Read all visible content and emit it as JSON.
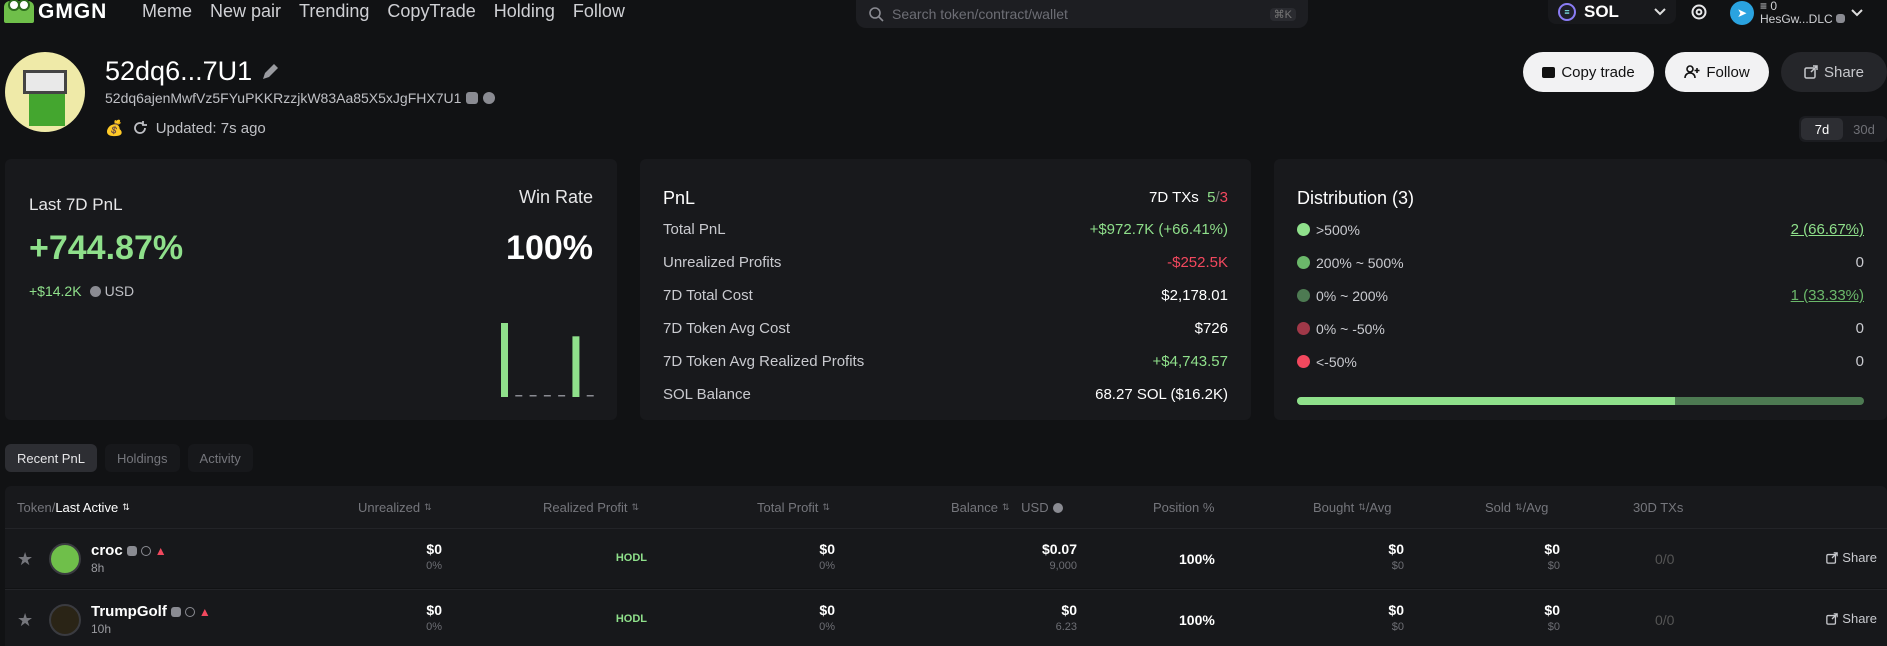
{
  "nav": {
    "logo_text": "GMGN",
    "items": [
      "Meme",
      "New pair",
      "Trending",
      "CopyTrade",
      "Holding",
      "Follow"
    ],
    "search_placeholder": "Search token/contract/wallet",
    "search_shortcut": "⌘K",
    "chain": "SOL",
    "account_balance": "0",
    "account_name": "HesGw...DLC"
  },
  "profile": {
    "title": "52dq6...7U1",
    "address": "52dq6ajenMwfVz5FYuPKKRzzjkW83Aa85X5xJgFHX7U1",
    "updated": "Updated: 7s ago",
    "buttons": {
      "copy_trade": "Copy trade",
      "follow": "Follow",
      "share": "Share"
    },
    "period_tabs": [
      "7d",
      "30d"
    ],
    "period_active": "7d"
  },
  "pnl_card": {
    "label": "Last 7D PnL",
    "value": "+744.87%",
    "usd_value": "+$14.2K",
    "usd_label": "USD",
    "win_rate_label": "Win Rate",
    "win_rate_value": "100%",
    "mini_bars": [
      1,
      0,
      0,
      0,
      0,
      0.82,
      0
    ]
  },
  "stats_card": {
    "title": "PnL",
    "txs_label": "7D TXs",
    "txs_win": "5",
    "txs_sep": "/",
    "txs_loss": "3",
    "rows": [
      {
        "label": "Total PnL",
        "value": "+$972.7K (+66.41%)",
        "tone": "green"
      },
      {
        "label": "Unrealized Profits",
        "value": "-$252.5K",
        "tone": "red"
      },
      {
        "label": "7D Total Cost",
        "value": "$2,178.01",
        "tone": "white"
      },
      {
        "label": "7D Token Avg Cost",
        "value": "$726",
        "tone": "white"
      },
      {
        "label": "7D Token Avg Realized Profits",
        "value": "+$4,743.57",
        "tone": "green"
      },
      {
        "label": "SOL Balance",
        "value": "68.27 SOL ($16.2K)",
        "tone": "white"
      }
    ]
  },
  "distribution": {
    "title": "Distribution (3)",
    "rows": [
      {
        "label": ">500%",
        "value": "2 (66.67%)",
        "color": "#8fe08b",
        "underline": true,
        "tone": "#8fe08b"
      },
      {
        "label": "200% ~ 500%",
        "value": "0",
        "color": "#6bb86a",
        "underline": false,
        "tone": "#c9cacf"
      },
      {
        "label": "0% ~ 200%",
        "value": "1 (33.33%)",
        "color": "#4d7a52",
        "underline": true,
        "tone": "#6bb86a"
      },
      {
        "label": "0% ~ -50%",
        "value": "0",
        "color": "#a03848",
        "underline": false,
        "tone": "#c9cacf"
      },
      {
        "label": "<-50%",
        "value": "0",
        "color": "#f2485e",
        "underline": false,
        "tone": "#c9cacf"
      }
    ],
    "bar_fill_fraction": 0.6667
  },
  "tabs": {
    "items": [
      "Recent PnL",
      "Holdings",
      "Activity"
    ],
    "active": "Recent PnL"
  },
  "table": {
    "headers": {
      "token": "Token/",
      "last_active": "Last Active",
      "unrealized": "Unrealized",
      "realized": "Realized Profit",
      "total": "Total Profit",
      "balance": "Balance",
      "usd": "USD",
      "position": "Position %",
      "bought": "Bought",
      "bought_avg": "/Avg",
      "sold": "Sold",
      "sold_avg": "/Avg",
      "txs": "30D TXs"
    },
    "rows": [
      {
        "name": "croc",
        "time": "8h",
        "unrealized": "$0",
        "unrealized_pct": "0%",
        "realized": "HODL",
        "total": "$0",
        "total_pct": "0%",
        "balance_usd": "$0.07",
        "balance_amt": "9,000",
        "position": "100%",
        "bought": "$0",
        "bought_avg": "$0",
        "sold": "$0",
        "sold_avg": "$0",
        "txs": "0/0",
        "share": "Share",
        "avatar_color": "#6fbf4a"
      },
      {
        "name": "TrumpGolf",
        "time": "10h",
        "unrealized": "$0",
        "unrealized_pct": "0%",
        "realized": "HODL",
        "total": "$0",
        "total_pct": "0%",
        "balance_usd": "$0",
        "balance_amt": "6.23",
        "position": "100%",
        "bought": "$0",
        "bought_avg": "$0",
        "sold": "$0",
        "sold_avg": "$0",
        "txs": "0/0",
        "share": "Share",
        "avatar_color": "#2a2416"
      }
    ]
  }
}
